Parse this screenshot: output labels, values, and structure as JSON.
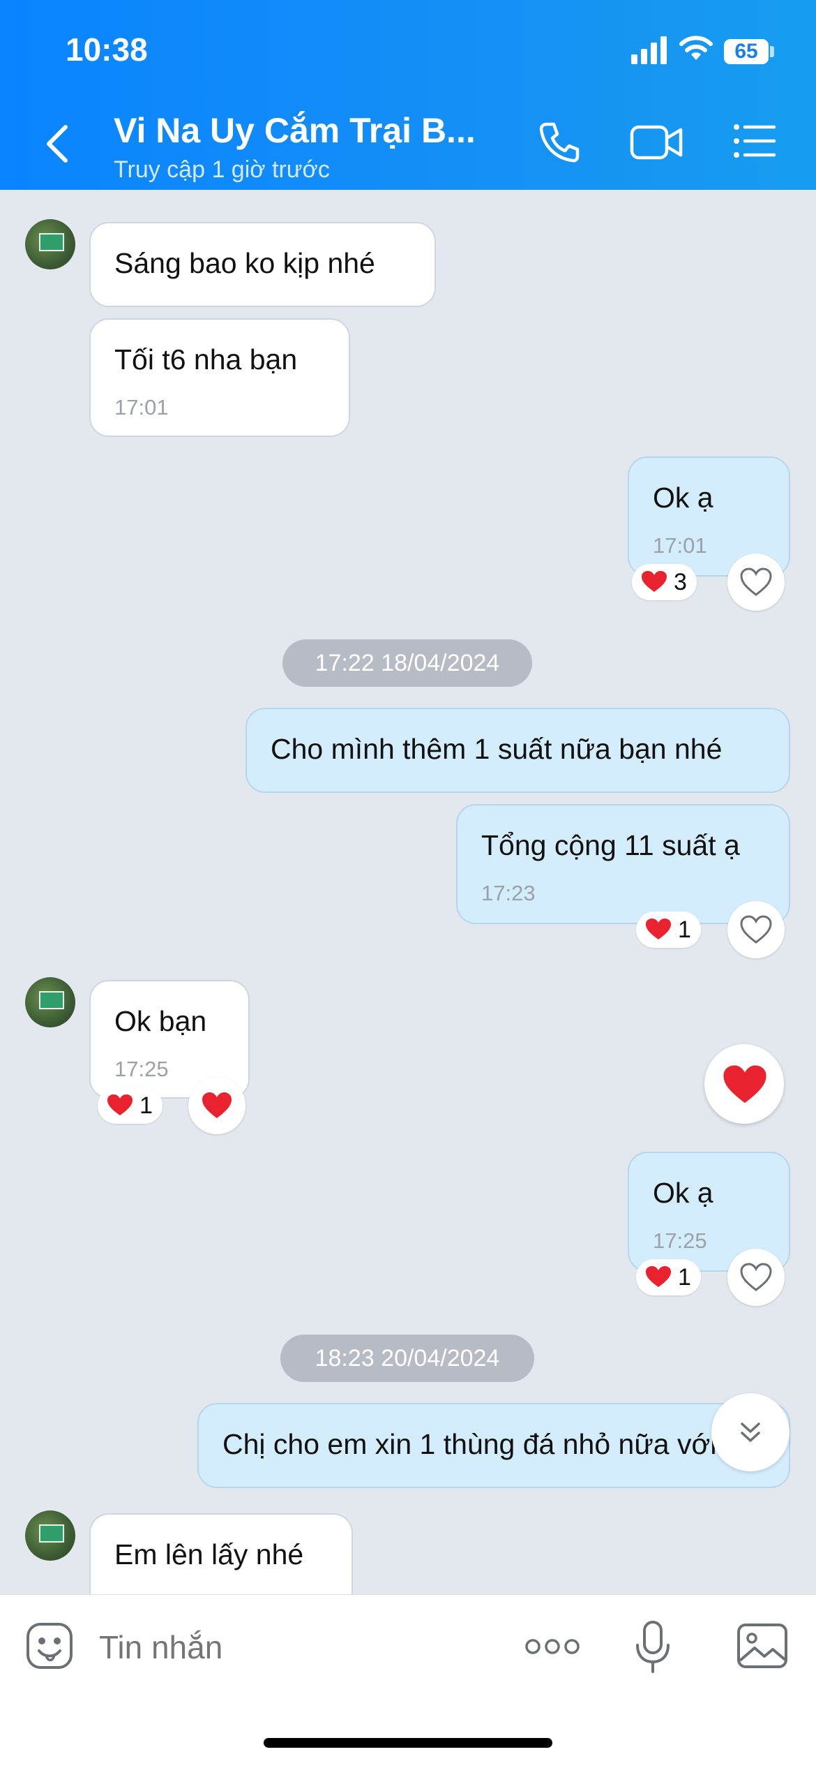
{
  "status_bar": {
    "time": "10:38",
    "battery": "65"
  },
  "header": {
    "title": "Vi Na Uy Cắm Trại B...",
    "subtitle": "Truy cập 1 giờ trước"
  },
  "messages": [
    {
      "text": "Sáng bao ko kịp nhé",
      "time": ""
    },
    {
      "text": "Tối t6 nha bạn",
      "time": "17:01"
    },
    {
      "text": "Ok ạ",
      "time": "17:01",
      "reaction_count": "3"
    },
    {
      "text": "Cho mình thêm 1 suất nữa bạn nhé",
      "time": ""
    },
    {
      "text": "Tổng cộng 11 suất ạ",
      "time": "17:23",
      "reaction_count": "1"
    },
    {
      "text": "Ok bạn",
      "time": "17:25",
      "reaction_count": "1"
    },
    {
      "text": "Ok ạ",
      "time": "17:25",
      "reaction_count": "1"
    },
    {
      "text": "Chị cho em xin 1 thùng đá nhỏ nữa với",
      "time": ""
    },
    {
      "text": "Em lên lấy nhé",
      "time": ""
    }
  ],
  "dates": [
    "17:22 18/04/2024",
    "18:23 20/04/2024"
  ],
  "input": {
    "placeholder": "Tin nhắn"
  },
  "colors": {
    "header": "#0a84ff",
    "outgoing_bubble": "#d4edfd",
    "heart": "#e8222e"
  },
  "icons": [
    "back-icon",
    "phone-icon",
    "video-call-icon",
    "menu-list-icon",
    "heart-icon",
    "chevrons-down-icon",
    "emoji-icon",
    "more-icon",
    "microphone-icon",
    "image-icon"
  ]
}
